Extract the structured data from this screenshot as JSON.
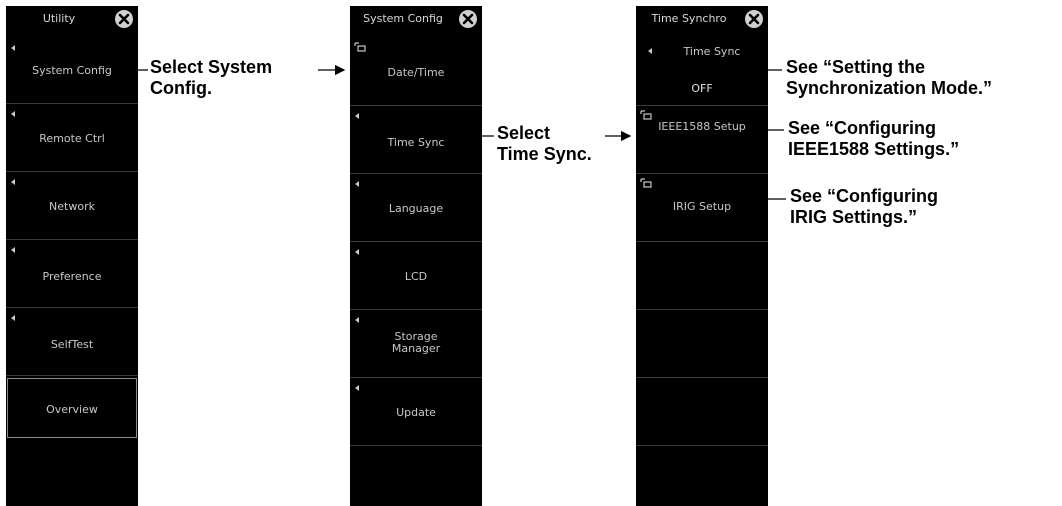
{
  "utility_panel": {
    "title": "Utility",
    "items": [
      {
        "label": "System Config"
      },
      {
        "label": "Remote Ctrl"
      },
      {
        "label": "Network"
      },
      {
        "label": "Preference"
      },
      {
        "label": "SelfTest"
      },
      {
        "label": "Overview"
      }
    ]
  },
  "system_config_panel": {
    "title": "System Config",
    "items": [
      {
        "label": "Date/Time"
      },
      {
        "label": "Time Sync"
      },
      {
        "label": "Language"
      },
      {
        "label": "LCD"
      },
      {
        "label": "Storage",
        "label2": "Manager"
      },
      {
        "label": "Update"
      }
    ]
  },
  "time_sync_panel": {
    "title": "Time Synchro",
    "items": [
      {
        "label": "Time Sync",
        "value": "OFF"
      },
      {
        "label": "IEEE1588 Setup"
      },
      {
        "label": "IRIG Setup"
      }
    ]
  },
  "callouts": {
    "select_system_config_line1": "Select System",
    "select_system_config_line2": "Config.",
    "select_time_sync_line1": "Select",
    "select_time_sync_line2": "Time Sync.",
    "sync_mode_line1": "See “Setting the",
    "sync_mode_line2": "Synchronization Mode.”",
    "ieee_line1": "See “Configuring",
    "ieee_line2": "IEEE1588 Settings.”",
    "irig_line1": "See “Configuring",
    "irig_line2": "IRIG Settings.”"
  }
}
